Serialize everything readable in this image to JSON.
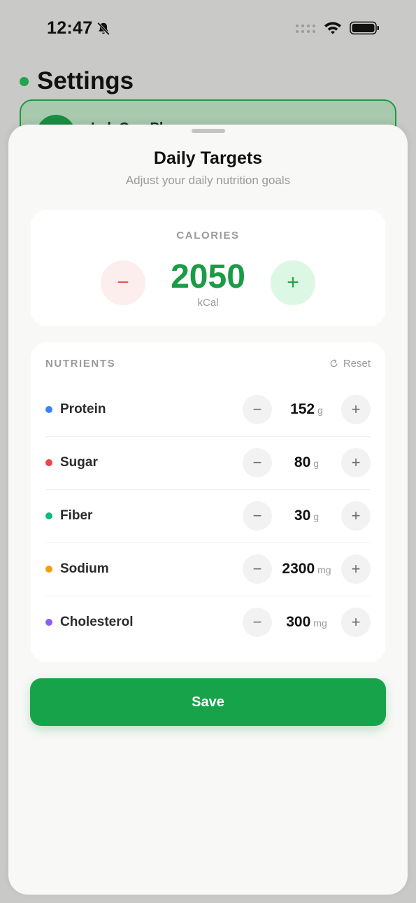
{
  "status_bar": {
    "time": "12:47"
  },
  "background": {
    "title": "Settings",
    "card_text": "LaleOne Pl"
  },
  "sheet": {
    "title": "Daily Targets",
    "subtitle": "Adjust your daily nutrition goals",
    "calories": {
      "label": "CALORIES",
      "value": "2050",
      "unit": "kCal",
      "minus": "−",
      "plus": "+"
    },
    "nutrients": {
      "label": "NUTRIENTS",
      "reset_label": "Reset",
      "items": [
        {
          "name": "Protein",
          "value": "152",
          "unit": "g",
          "color": "#3b82f6"
        },
        {
          "name": "Sugar",
          "value": "80",
          "unit": "g",
          "color": "#ef4444"
        },
        {
          "name": "Fiber",
          "value": "30",
          "unit": "g",
          "color": "#10b981"
        },
        {
          "name": "Sodium",
          "value": "2300",
          "unit": "mg",
          "color": "#f59e0b"
        },
        {
          "name": "Cholesterol",
          "value": "300",
          "unit": "mg",
          "color": "#8b5cf6"
        }
      ],
      "minus": "−",
      "plus": "+"
    },
    "save_label": "Save"
  },
  "colors": {
    "accent": "#17a34a",
    "calorie_value": "#1a9b45",
    "minus_tint": "#fdeeee",
    "plus_tint": "#dcf7e3"
  }
}
